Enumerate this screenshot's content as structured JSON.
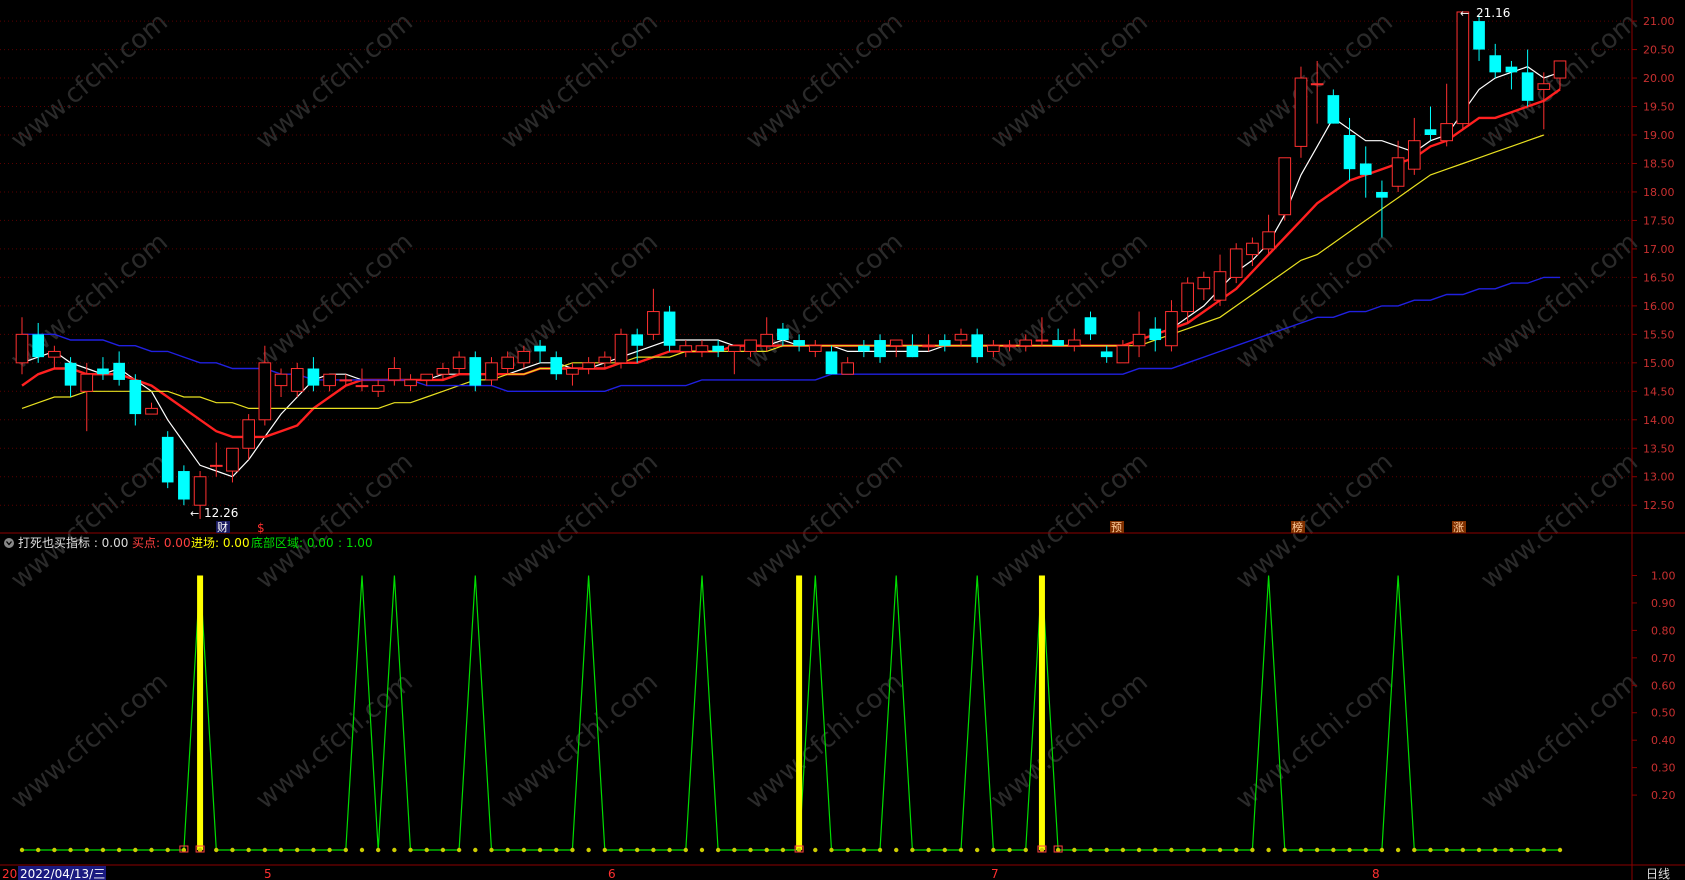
{
  "watermark": "www.cfchi.com",
  "period_label": "日线",
  "date_label": "2022/04/13/三",
  "date_prefix": "20",
  "month_markers": [
    "5",
    "6",
    "7",
    "8"
  ],
  "event_markers": [
    "财",
    "$",
    "预",
    "榜",
    "涨"
  ],
  "extreme_labels": {
    "high": "21.16",
    "low": "12.26"
  },
  "indicator_header": {
    "name": "打死也买指标 : 0.00",
    "buy_label": "买点: 0.00",
    "enter_label": "进场: 0.00",
    "bottom_label": "底部区域: 0.00",
    "extra_label": ": 1.00"
  },
  "colors": {
    "background": "#000000",
    "frame": "#8b0000",
    "grid": "#5a0000",
    "axis_text": "#c83030",
    "up_candle": "#ff3030",
    "down_candle": "#00ffff",
    "ma5": "#ffffff",
    "ma10": "#ff2020",
    "ma20": "#e8e020",
    "ma60": "#2020e0",
    "buy": "#ff4040",
    "enter": "#ffff00",
    "bottom": "#00dd00",
    "dots": "#cccc00"
  },
  "chart_data": [
    {
      "type": "candlestick",
      "y_ticks": [
        "21.00",
        "20.50",
        "20.00",
        "19.50",
        "19.00",
        "18.50",
        "18.00",
        "17.50",
        "17.00",
        "16.50",
        "16.00",
        "15.50",
        "15.00",
        "14.50",
        "14.00",
        "13.50",
        "13.00",
        "12.50"
      ],
      "ylim": [
        12.1,
        21.3
      ],
      "grid": true,
      "candles": [
        [
          15.0,
          15.8,
          14.8,
          15.5
        ],
        [
          15.5,
          15.7,
          15.0,
          15.1
        ],
        [
          15.1,
          15.3,
          14.9,
          15.2
        ],
        [
          15.0,
          15.1,
          14.4,
          14.6
        ],
        [
          14.5,
          15.0,
          13.8,
          14.8
        ],
        [
          14.9,
          15.1,
          14.7,
          14.8
        ],
        [
          15.0,
          15.2,
          14.6,
          14.7
        ],
        [
          14.7,
          14.8,
          13.9,
          14.1
        ],
        [
          14.1,
          14.3,
          14.1,
          14.2
        ],
        [
          13.7,
          13.8,
          12.8,
          12.9
        ],
        [
          13.1,
          13.2,
          12.5,
          12.6
        ],
        [
          12.5,
          13.1,
          12.26,
          13.0
        ],
        [
          13.2,
          13.6,
          13.0,
          13.2
        ],
        [
          13.1,
          13.4,
          12.9,
          13.5
        ],
        [
          13.5,
          14.1,
          13.3,
          14.0
        ],
        [
          14.0,
          15.3,
          13.9,
          15.0
        ],
        [
          14.6,
          14.9,
          14.4,
          14.8
        ],
        [
          14.5,
          15.0,
          14.4,
          14.9
        ],
        [
          14.9,
          15.1,
          14.5,
          14.6
        ],
        [
          14.6,
          14.8,
          14.5,
          14.8
        ],
        [
          14.7,
          14.8,
          14.6,
          14.7
        ],
        [
          14.6,
          14.9,
          14.5,
          14.6
        ],
        [
          14.5,
          14.7,
          14.4,
          14.6
        ],
        [
          14.7,
          15.1,
          14.6,
          14.9
        ],
        [
          14.6,
          14.8,
          14.5,
          14.7
        ],
        [
          14.7,
          14.8,
          14.6,
          14.8
        ],
        [
          14.8,
          15.0,
          14.7,
          14.9
        ],
        [
          14.9,
          15.2,
          14.8,
          15.1
        ],
        [
          15.1,
          15.2,
          14.5,
          14.6
        ],
        [
          14.7,
          15.1,
          14.6,
          15.0
        ],
        [
          14.9,
          15.2,
          14.8,
          15.1
        ],
        [
          15.0,
          15.3,
          14.9,
          15.2
        ],
        [
          15.3,
          15.4,
          15.0,
          15.2
        ],
        [
          15.1,
          15.2,
          14.7,
          14.8
        ],
        [
          14.8,
          15.0,
          14.6,
          14.9
        ],
        [
          14.9,
          15.1,
          14.8,
          15.0
        ],
        [
          15.0,
          15.2,
          14.9,
          15.1
        ],
        [
          15.0,
          15.6,
          14.9,
          15.5
        ],
        [
          15.5,
          15.6,
          15.0,
          15.3
        ],
        [
          15.5,
          16.3,
          15.4,
          15.9
        ],
        [
          15.9,
          16.0,
          15.2,
          15.3
        ],
        [
          15.2,
          15.4,
          15.1,
          15.3
        ],
        [
          15.2,
          15.4,
          15.1,
          15.3
        ],
        [
          15.3,
          15.4,
          15.1,
          15.2
        ],
        [
          15.2,
          15.3,
          14.8,
          15.3
        ],
        [
          15.2,
          15.4,
          15.1,
          15.4
        ],
        [
          15.3,
          15.8,
          15.2,
          15.5
        ],
        [
          15.6,
          15.7,
          15.3,
          15.4
        ],
        [
          15.4,
          15.5,
          15.2,
          15.3
        ],
        [
          15.2,
          15.4,
          15.1,
          15.3
        ],
        [
          15.2,
          15.3,
          14.8,
          14.8
        ],
        [
          14.8,
          15.1,
          14.8,
          15.0
        ],
        [
          15.3,
          15.4,
          15.1,
          15.2
        ],
        [
          15.4,
          15.5,
          15.0,
          15.1
        ],
        [
          15.3,
          15.4,
          15.1,
          15.4
        ],
        [
          15.3,
          15.5,
          15.1,
          15.1
        ],
        [
          15.3,
          15.5,
          15.2,
          15.3
        ],
        [
          15.4,
          15.5,
          15.2,
          15.3
        ],
        [
          15.4,
          15.6,
          15.3,
          15.5
        ],
        [
          15.5,
          15.6,
          15.0,
          15.1
        ],
        [
          15.2,
          15.4,
          15.1,
          15.3
        ],
        [
          15.3,
          15.4,
          15.2,
          15.3
        ],
        [
          15.3,
          15.5,
          15.2,
          15.4
        ],
        [
          15.4,
          15.8,
          15.3,
          15.4
        ],
        [
          15.4,
          15.6,
          15.3,
          15.3
        ],
        [
          15.3,
          15.6,
          15.2,
          15.4
        ],
        [
          15.8,
          15.9,
          15.4,
          15.5
        ],
        [
          15.2,
          15.3,
          15.0,
          15.1
        ],
        [
          15.0,
          15.4,
          15.0,
          15.3
        ],
        [
          15.3,
          15.9,
          15.1,
          15.5
        ],
        [
          15.6,
          15.8,
          15.2,
          15.4
        ],
        [
          15.3,
          16.1,
          15.2,
          15.9
        ],
        [
          15.9,
          16.5,
          15.7,
          16.4
        ],
        [
          16.3,
          16.6,
          16.1,
          16.5
        ],
        [
          16.1,
          16.9,
          16.0,
          16.6
        ],
        [
          16.5,
          17.1,
          16.4,
          17.0
        ],
        [
          16.9,
          17.2,
          16.7,
          17.1
        ],
        [
          17.0,
          17.6,
          16.9,
          17.3
        ],
        [
          17.6,
          18.3,
          17.5,
          18.6
        ],
        [
          18.8,
          20.2,
          18.6,
          20.0
        ],
        [
          19.9,
          20.3,
          19.2,
          19.9
        ],
        [
          19.7,
          19.8,
          19.2,
          19.2
        ],
        [
          19.0,
          19.3,
          18.2,
          18.4
        ],
        [
          18.5,
          18.8,
          17.9,
          18.3
        ],
        [
          18.0,
          18.2,
          17.2,
          17.9
        ],
        [
          18.1,
          18.9,
          18.0,
          18.6
        ],
        [
          18.4,
          19.3,
          18.3,
          18.9
        ],
        [
          19.1,
          19.5,
          18.9,
          19.0
        ],
        [
          18.9,
          19.9,
          18.8,
          19.2
        ],
        [
          19.2,
          21.16,
          19.1,
          21.16
        ],
        [
          21.0,
          21.1,
          20.3,
          20.5
        ],
        [
          20.4,
          20.6,
          20.0,
          20.1
        ],
        [
          20.2,
          20.3,
          19.8,
          20.1
        ],
        [
          20.1,
          20.5,
          19.5,
          19.6
        ],
        [
          19.8,
          20.1,
          19.1,
          19.9
        ],
        [
          20.0,
          20.3,
          19.8,
          20.3
        ]
      ],
      "series": [
        {
          "name": "",
          "color": "#ffffff",
          "values": [
            15.0,
            15.1,
            15.2,
            15.0,
            14.9,
            14.8,
            14.9,
            14.7,
            14.5,
            14.0,
            13.6,
            13.2,
            13.1,
            13.0,
            13.3,
            13.7,
            14.1,
            14.4,
            14.7,
            14.8,
            14.8,
            14.7,
            14.7,
            14.7,
            14.7,
            14.7,
            14.8,
            14.8,
            14.8,
            14.8,
            14.8,
            14.9,
            15.0,
            15.0,
            14.9,
            14.9,
            15.0,
            15.1,
            15.2,
            15.3,
            15.4,
            15.4,
            15.4,
            15.4,
            15.3,
            15.3,
            15.3,
            15.4,
            15.3,
            15.3,
            15.3,
            15.2,
            15.2,
            15.2,
            15.2,
            15.2,
            15.2,
            15.3,
            15.3,
            15.3,
            15.3,
            15.3,
            15.3,
            15.3,
            15.3,
            15.3,
            15.3,
            15.3,
            15.3,
            15.4,
            15.5,
            15.6,
            15.8,
            16.0,
            16.3,
            16.6,
            16.8,
            17.1,
            17.6,
            18.3,
            18.8,
            19.3,
            19.1,
            18.9,
            18.9,
            18.8,
            18.7,
            18.9,
            19.0,
            19.4,
            19.8,
            20.0,
            20.1,
            20.2,
            20.0,
            20.1
          ]
        },
        {
          "name": "",
          "color": "#ff2020",
          "values": [
            14.6,
            14.8,
            14.9,
            14.9,
            14.8,
            14.8,
            14.8,
            14.7,
            14.6,
            14.4,
            14.2,
            14.0,
            13.8,
            13.7,
            13.7,
            13.7,
            13.8,
            13.9,
            14.2,
            14.4,
            14.6,
            14.7,
            14.7,
            14.7,
            14.7,
            14.7,
            14.7,
            14.8,
            14.8,
            14.8,
            14.8,
            14.8,
            14.9,
            14.9,
            14.9,
            14.9,
            14.9,
            15.0,
            15.0,
            15.1,
            15.2,
            15.2,
            15.2,
            15.2,
            15.3,
            15.3,
            15.3,
            15.3,
            15.3,
            15.3,
            15.3,
            15.3,
            15.3,
            15.3,
            15.3,
            15.3,
            15.3,
            15.3,
            15.3,
            15.3,
            15.3,
            15.3,
            15.3,
            15.3,
            15.3,
            15.3,
            15.3,
            15.3,
            15.3,
            15.4,
            15.5,
            15.6,
            15.7,
            15.9,
            16.1,
            16.3,
            16.6,
            16.9,
            17.2,
            17.5,
            17.8,
            18.0,
            18.2,
            18.3,
            18.4,
            18.5,
            18.6,
            18.8,
            18.9,
            19.1,
            19.3,
            19.3,
            19.4,
            19.5,
            19.6,
            19.8
          ]
        },
        {
          "name": "",
          "color": "#e8e020",
          "values": [
            14.2,
            14.3,
            14.4,
            14.4,
            14.5,
            14.5,
            14.5,
            14.5,
            14.5,
            14.5,
            14.4,
            14.4,
            14.3,
            14.3,
            14.2,
            14.2,
            14.2,
            14.2,
            14.2,
            14.2,
            14.2,
            14.2,
            14.2,
            14.3,
            14.3,
            14.4,
            14.5,
            14.6,
            14.7,
            14.7,
            14.8,
            14.8,
            14.9,
            14.9,
            15.0,
            15.0,
            15.0,
            15.0,
            15.1,
            15.1,
            15.1,
            15.2,
            15.2,
            15.2,
            15.2,
            15.2,
            15.2,
            15.3,
            15.3,
            15.3,
            15.3,
            15.3,
            15.3,
            15.3,
            15.3,
            15.3,
            15.3,
            15.3,
            15.3,
            15.3,
            15.3,
            15.3,
            15.3,
            15.3,
            15.3,
            15.3,
            15.3,
            15.3,
            15.3,
            15.3,
            15.4,
            15.5,
            15.6,
            15.7,
            15.8,
            16.0,
            16.2,
            16.4,
            16.6,
            16.8,
            16.9,
            17.1,
            17.3,
            17.5,
            17.7,
            17.9,
            18.1,
            18.3,
            18.4,
            18.5,
            18.6,
            18.7,
            18.8,
            18.9,
            19.0
          ]
        },
        {
          "name": "",
          "color": "#2020e0",
          "values": [
            15.5,
            15.5,
            15.5,
            15.4,
            15.4,
            15.4,
            15.3,
            15.3,
            15.2,
            15.2,
            15.1,
            15.0,
            15.0,
            14.9,
            14.9,
            14.9,
            14.8,
            14.8,
            14.7,
            14.7,
            14.7,
            14.7,
            14.7,
            14.7,
            14.7,
            14.6,
            14.6,
            14.6,
            14.6,
            14.6,
            14.5,
            14.5,
            14.5,
            14.5,
            14.5,
            14.5,
            14.5,
            14.6,
            14.6,
            14.6,
            14.6,
            14.6,
            14.7,
            14.7,
            14.7,
            14.7,
            14.7,
            14.7,
            14.7,
            14.7,
            14.8,
            14.8,
            14.8,
            14.8,
            14.8,
            14.8,
            14.8,
            14.8,
            14.8,
            14.8,
            14.8,
            14.8,
            14.8,
            14.8,
            14.8,
            14.8,
            14.8,
            14.8,
            14.8,
            14.9,
            14.9,
            14.9,
            15.0,
            15.1,
            15.2,
            15.3,
            15.4,
            15.5,
            15.6,
            15.7,
            15.8,
            15.8,
            15.9,
            15.9,
            16.0,
            16.0,
            16.1,
            16.1,
            16.2,
            16.2,
            16.3,
            16.3,
            16.4,
            16.4,
            16.5,
            16.5
          ]
        }
      ]
    },
    {
      "type": "line",
      "y_ticks": [
        "1.00",
        "0.90",
        "0.80",
        "0.70",
        "0.60",
        "0.50",
        "0.40",
        "0.30",
        "0.20"
      ],
      "ylim": [
        0,
        1.02
      ],
      "grid": false,
      "bottom_peaks": [
        11,
        21,
        23,
        28,
        35,
        42,
        49,
        54,
        59,
        63,
        77,
        85
      ],
      "enter_bars": [
        11,
        48,
        63
      ],
      "buy_bars": [
        10,
        11,
        48,
        63,
        64
      ]
    }
  ]
}
